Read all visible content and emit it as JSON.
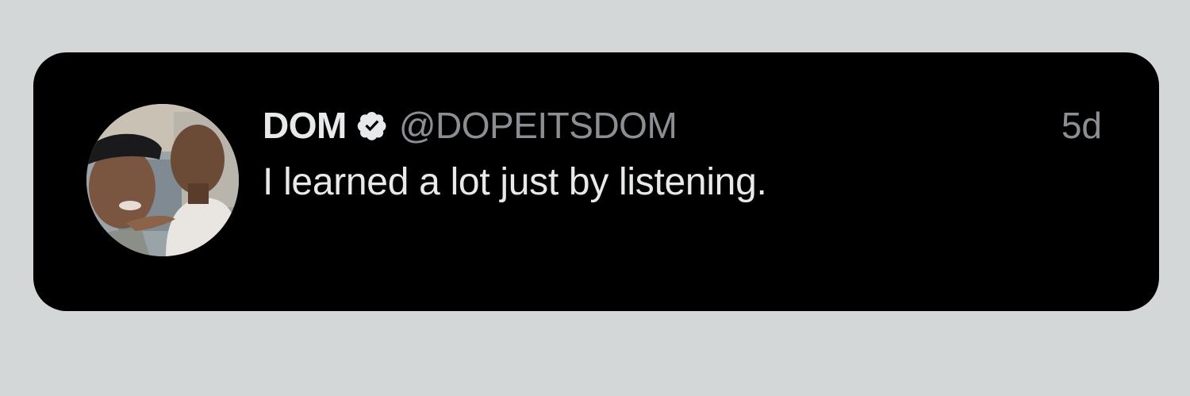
{
  "tweet": {
    "display_name": "DOM",
    "handle": "@DOPEITSDOM",
    "time_ago": "5d",
    "text": "I learned a lot just by listening.",
    "verified": true
  },
  "icons": {
    "verified": "verified-badge-icon",
    "avatar": "profile-photo"
  },
  "colors": {
    "background": "#d4d7d8",
    "card": "#000000",
    "primary_text": "#e7e9ea",
    "secondary_text": "#8b8f93"
  }
}
